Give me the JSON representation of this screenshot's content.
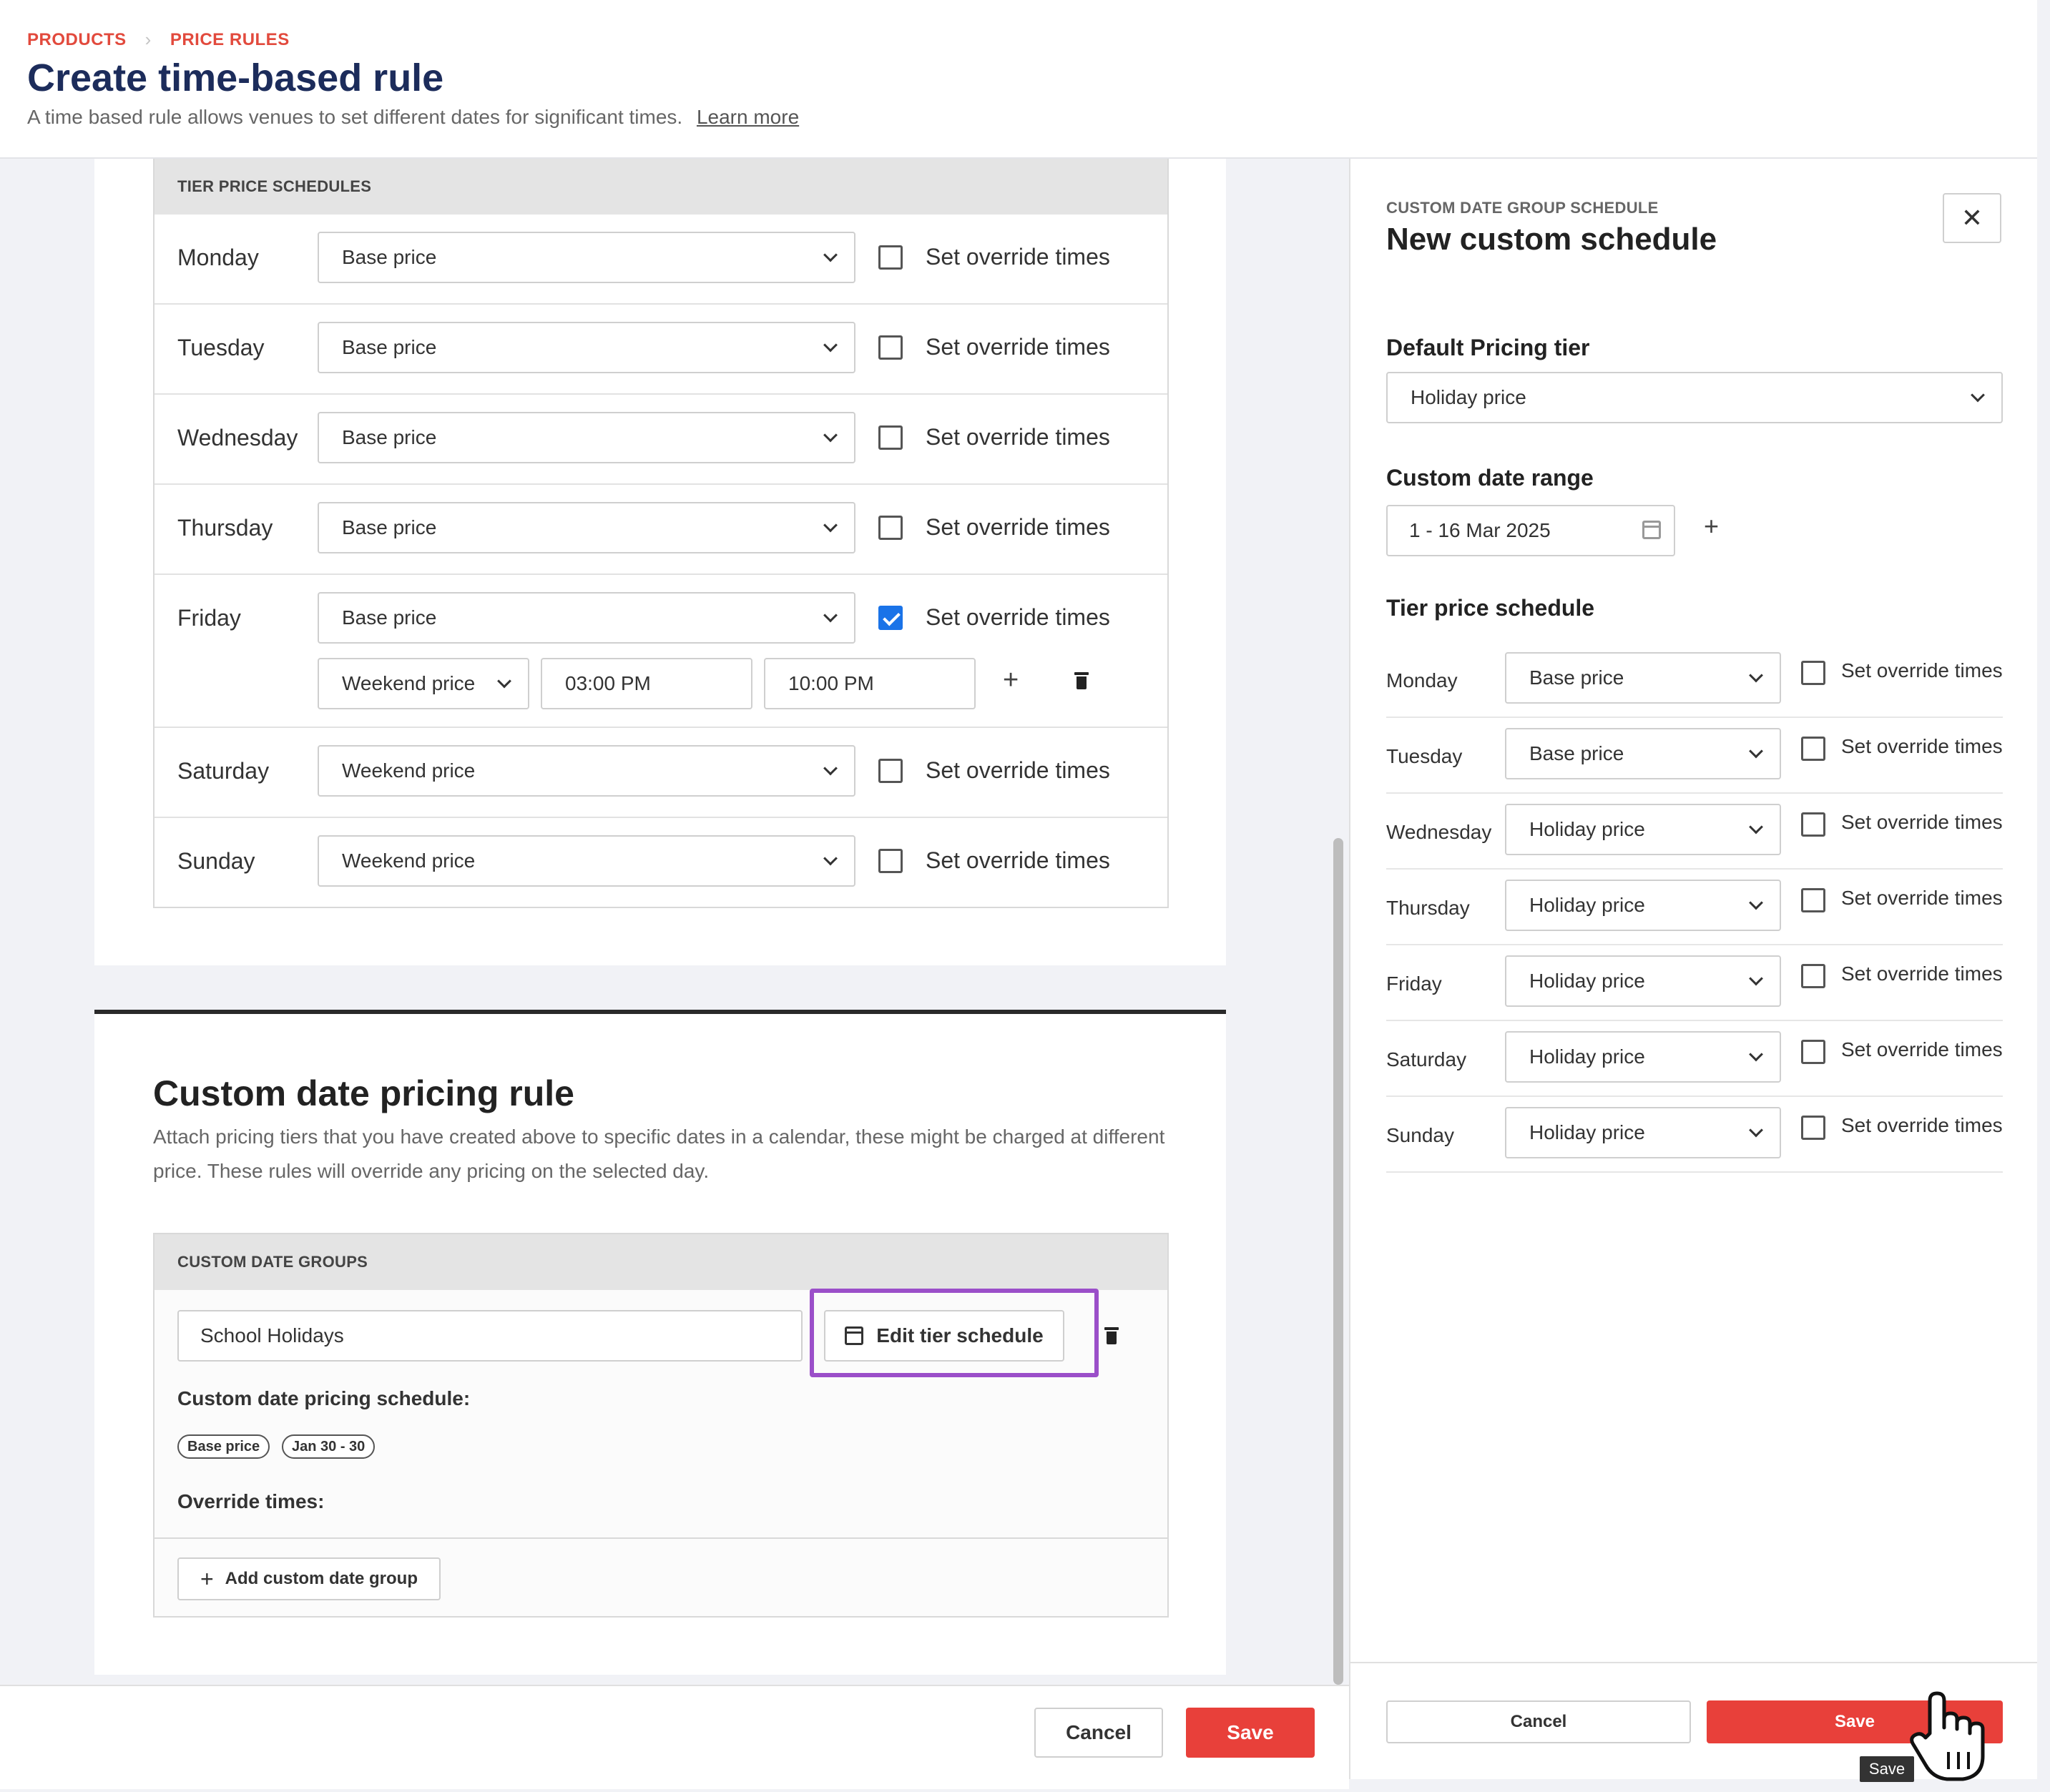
{
  "header": {
    "breadcrumb": [
      "PRODUCTS",
      "PRICE RULES"
    ],
    "title": "Create time-based rule",
    "description": "A time based rule allows venues to set different dates for significant times.",
    "learn_more": "Learn more"
  },
  "tier_schedules": {
    "heading": "TIER PRICE SCHEDULES",
    "checkbox_label": "Set override times",
    "days": [
      {
        "name": "Monday",
        "tier": "Base price",
        "override": false
      },
      {
        "name": "Tuesday",
        "tier": "Base price",
        "override": false
      },
      {
        "name": "Wednesday",
        "tier": "Base price",
        "override": false
      },
      {
        "name": "Thursday",
        "tier": "Base price",
        "override": false
      },
      {
        "name": "Friday",
        "tier": "Base price",
        "override": true
      },
      {
        "name": "Saturday",
        "tier": "Weekend price",
        "override": false
      },
      {
        "name": "Sunday",
        "tier": "Weekend price",
        "override": false
      }
    ],
    "friday_override": {
      "tier": "Weekend price",
      "start": "03:00 PM",
      "end": "10:00 PM"
    }
  },
  "custom_date_rule": {
    "title": "Custom date pricing rule",
    "description": "Attach pricing tiers that you have created above to specific dates in a calendar, these might be charged at different price. These rules will override any pricing on the selected day.",
    "groups_heading": "CUSTOM DATE GROUPS",
    "group_name": "School Holidays",
    "edit_button": "Edit tier schedule",
    "schedule_label": "Custom date pricing schedule:",
    "chips": [
      "Base price",
      "Jan 30 - 30"
    ],
    "override_label": "Override times:",
    "add_group": "Add custom date group"
  },
  "footer": {
    "cancel": "Cancel",
    "save": "Save"
  },
  "drawer": {
    "kicker": "CUSTOM DATE GROUP SCHEDULE",
    "title": "New custom schedule",
    "close": "✕",
    "default_tier_label": "Default Pricing tier",
    "default_tier": "Holiday price",
    "date_range_label": "Custom date range",
    "date_range": "1 - 16 Mar 2025",
    "add": "+",
    "schedule_label": "Tier price schedule",
    "checkbox_label": "Set override times",
    "days": [
      {
        "name": "Monday",
        "tier": "Base price"
      },
      {
        "name": "Tuesday",
        "tier": "Base price"
      },
      {
        "name": "Wednesday",
        "tier": "Holiday price"
      },
      {
        "name": "Thursday",
        "tier": "Holiday price"
      },
      {
        "name": "Friday",
        "tier": "Holiday price"
      },
      {
        "name": "Saturday",
        "tier": "Holiday price"
      },
      {
        "name": "Sunday",
        "tier": "Holiday price"
      }
    ],
    "cancel": "Cancel",
    "save": "Save",
    "tooltip": "Save"
  },
  "colors": {
    "brand_red": "#e8403a",
    "title_navy": "#1c2c5b",
    "highlight_purple": "#9b4fc9",
    "check_blue": "#1a73e8"
  }
}
